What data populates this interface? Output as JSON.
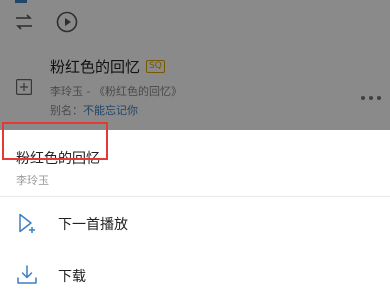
{
  "song": {
    "title": "粉红色的回忆",
    "quality_badge": "SQ",
    "artist_album": "李玲玉 - 《粉红色的回忆》",
    "alias_label": "别名：",
    "alias_value": "不能忘记你"
  },
  "sheet": {
    "title": "粉红色的回忆",
    "subtitle": "李玲玉",
    "actions": [
      {
        "label": "下一首播放",
        "icon": "play-next-icon"
      },
      {
        "label": "下载",
        "icon": "download-icon"
      }
    ]
  },
  "colors": {
    "accent_blue": "#3d7fc2",
    "badge_gold": "#d8a400",
    "highlight_red": "#e53935"
  }
}
